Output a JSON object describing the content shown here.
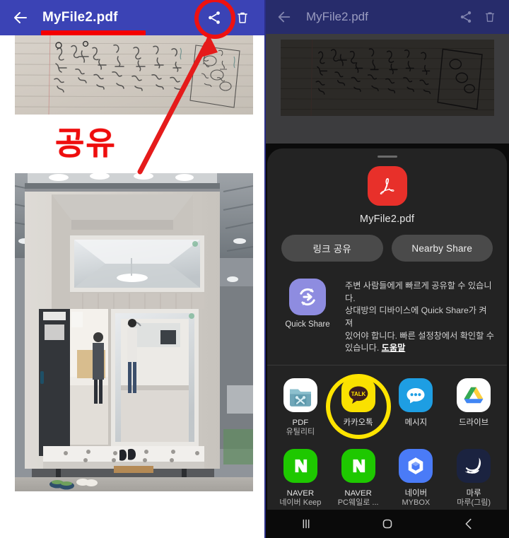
{
  "left_panel": {
    "appbar": {
      "back_icon": "arrow-left-icon",
      "title": "MyFile2.pdf",
      "share_icon": "share-icon",
      "delete_icon": "trash-icon"
    },
    "annotation": {
      "share_word": "공유",
      "underline_color": "#f40000",
      "ring_color": "#ee1111",
      "arrow_color": "#e51b1b"
    },
    "documents": [
      {
        "name": "handwritten-notebook-page"
      },
      {
        "name": "modular-house-exhibition-photo"
      }
    ]
  },
  "right_panel": {
    "appbar": {
      "back_icon": "arrow-left-icon",
      "title": "MyFile2.pdf",
      "share_icon": "share-icon",
      "delete_icon": "trash-icon"
    },
    "share_sheet": {
      "grabber": "drag-handle",
      "file_icon": "pdf-icon",
      "file_name": "MyFile2.pdf",
      "pills": [
        {
          "label": "링크 공유"
        },
        {
          "label": "Nearby Share"
        }
      ],
      "quick_share": {
        "icon": "quick-share-icon",
        "label": "Quick Share",
        "description_line1": "주변 사람들에게 빠르게 공유할 수 있습니다.",
        "description_line2": "상대방의 디바이스에 Quick Share가 켜져",
        "description_line3": "있어야 합니다. 빠른 설정창에서 확인할 수",
        "description_line4": "있습니다.",
        "help_link": "도움말"
      },
      "apps": [
        {
          "icon": "pdf-utility-icon",
          "label": "PDF",
          "label2": "유틸리티",
          "highlighted": false
        },
        {
          "icon": "kakaotalk-icon",
          "label": "카카오톡",
          "label2": "",
          "highlighted": true
        },
        {
          "icon": "messages-icon",
          "label": "메시지",
          "label2": "",
          "highlighted": false
        },
        {
          "icon": "google-drive-icon",
          "label": "드라이브",
          "label2": "",
          "highlighted": false
        },
        {
          "icon": "naver-keep-icon",
          "label": "NAVER",
          "label2": "네이버 Keep",
          "highlighted": false
        },
        {
          "icon": "naver-pc-icon",
          "label": "NAVER",
          "label2": "PC웨일로 ...",
          "highlighted": false
        },
        {
          "icon": "naver-mybox-icon",
          "label": "네이버",
          "label2": "MYBOX",
          "highlighted": false
        },
        {
          "icon": "maru-icon",
          "label": "마루",
          "label2": "마루(그림)",
          "highlighted": false
        }
      ],
      "highlight_ring_color": "#ffe400"
    },
    "navbar": {
      "recents_icon": "|||",
      "home_icon": "◯",
      "back_icon": "‹"
    }
  }
}
